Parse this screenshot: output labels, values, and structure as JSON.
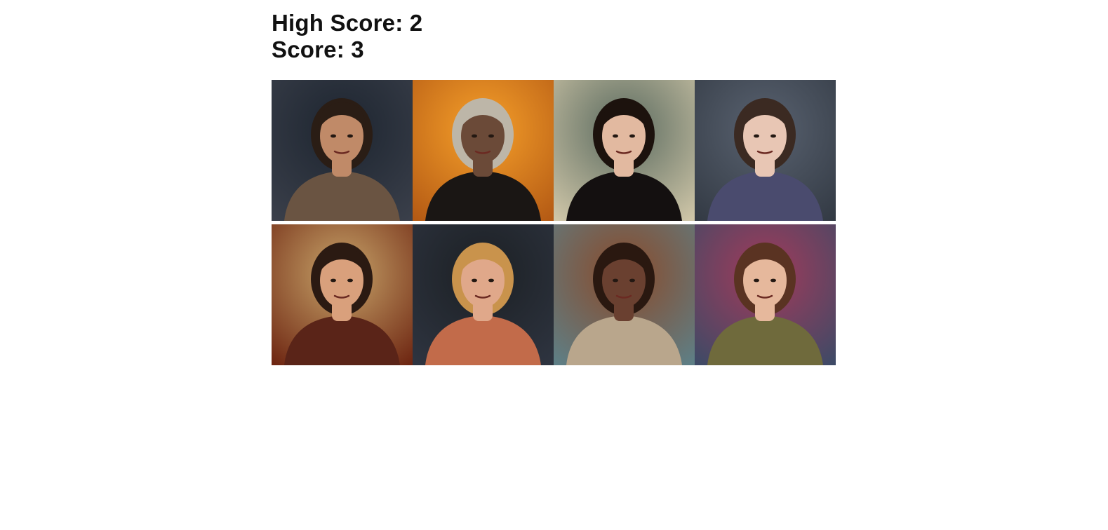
{
  "scoreboard": {
    "high_score_label": "High Score: 2",
    "score_label": "Score: 3"
  },
  "cards": [
    {
      "name": "card-portrait-1",
      "bg": "#3a3f4a",
      "skin": "#c08a68",
      "hair": "#2a1d15",
      "shirt": "#6a5442",
      "accent": "#1d2530"
    },
    {
      "name": "card-portrait-2",
      "bg": "#b45a14",
      "skin": "#6b4a38",
      "hair": "#bdb6a8",
      "shirt": "#1a1614",
      "accent": "#f6a02a"
    },
    {
      "name": "card-portrait-3",
      "bg": "#cfc6a8",
      "skin": "#e2b9a0",
      "hair": "#1c120d",
      "shirt": "#141010",
      "accent": "#5a6a5f"
    },
    {
      "name": "card-portrait-4",
      "bg": "#333a44",
      "skin": "#e8c6b4",
      "hair": "#3b2a22",
      "shirt": "#4a4b6e",
      "accent": "#596270"
    },
    {
      "name": "card-portrait-5",
      "bg": "#6e2612",
      "skin": "#d9a07c",
      "hair": "#2b1a12",
      "shirt": "#5a2418",
      "accent": "#c8a56a"
    },
    {
      "name": "card-portrait-6",
      "bg": "#2e3440",
      "skin": "#e0a88a",
      "hair": "#c9934c",
      "shirt": "#c26b4a",
      "accent": "#1c2024"
    },
    {
      "name": "card-portrait-7",
      "bg": "#5e7f86",
      "skin": "#6a4030",
      "hair": "#2a1810",
      "shirt": "#b9a68c",
      "accent": "#8a4a2a"
    },
    {
      "name": "card-portrait-8",
      "bg": "#3e4a66",
      "skin": "#e6b89c",
      "hair": "#5a3322",
      "shirt": "#6f6a3c",
      "accent": "#a23a5a"
    }
  ]
}
